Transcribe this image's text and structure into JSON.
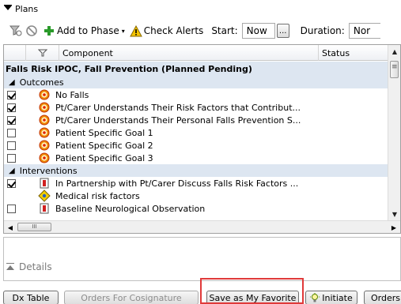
{
  "panel": {
    "title": "Plans"
  },
  "toolbar": {
    "add_to_phase": "Add to Phase",
    "check_alerts": "Check Alerts",
    "start_label": "Start:",
    "start_value": "Now",
    "ellipsis": "...",
    "duration_label": "Duration:",
    "duration_value": "Nor"
  },
  "grid": {
    "columns": {
      "component": "Component",
      "status": "Status"
    },
    "plan_title": "Falls Risk IPOC, Fall Prevention (Planned Pending)",
    "sections": [
      {
        "label": "Outcomes",
        "items": [
          {
            "checked": true,
            "icon": "target-icon",
            "label": "No Falls"
          },
          {
            "checked": true,
            "icon": "target-icon",
            "label": "Pt/Carer Understands Their Risk Factors that Contribut..."
          },
          {
            "checked": true,
            "icon": "target-icon",
            "label": "Pt/Carer Understands Their Personal Falls Prevention S..."
          },
          {
            "checked": false,
            "icon": "target-icon",
            "label": "Patient Specific Goal 1"
          },
          {
            "checked": false,
            "icon": "target-icon",
            "label": "Patient Specific Goal 2"
          },
          {
            "checked": false,
            "icon": "target-icon",
            "label": "Patient Specific Goal 3"
          }
        ]
      },
      {
        "label": "Interventions",
        "items": [
          {
            "checked": true,
            "icon": "order-icon",
            "label": "In Partnership with Pt/Carer Discuss Falls Risk Factors ..."
          },
          {
            "checked": null,
            "icon": "caution-icon",
            "label": "Medical risk factors"
          },
          {
            "checked": false,
            "icon": "order-icon",
            "label": "Baseline Neurological Observation"
          }
        ]
      }
    ],
    "hscroll_thumb": "III"
  },
  "details": {
    "label": "Details"
  },
  "footer": {
    "dx_table": "Dx Table",
    "orders_cosign": "Orders For Cosignature",
    "save_favorite": "Save as My Favorite",
    "initiate": "Initiate",
    "orders": "Orders"
  },
  "colors": {
    "section_bg": "#dde6f1",
    "highlight": "#e03a3a",
    "add_green": "#2a9a2a",
    "alert_yellow": "#f4c400"
  }
}
